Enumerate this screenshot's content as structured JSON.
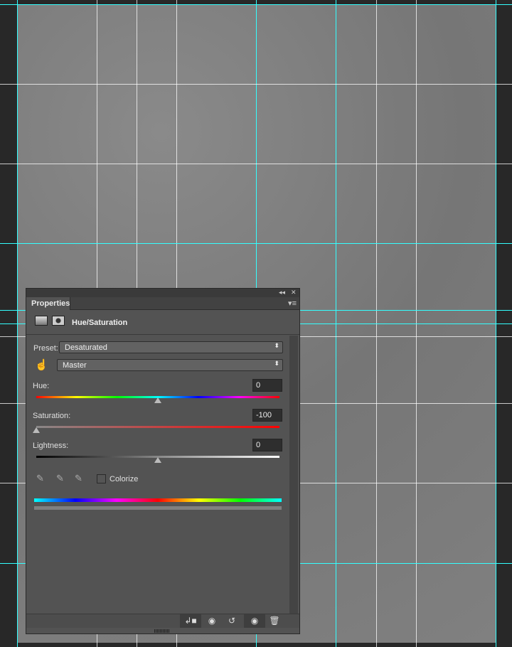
{
  "panel": {
    "tab": "Properties",
    "title": "Hue/Saturation",
    "preset_label": "Preset:",
    "preset_value": "Desaturated",
    "channel_value": "Master",
    "hue": {
      "label": "Hue:",
      "value": "0",
      "fraction": 0.5
    },
    "saturation": {
      "label": "Saturation:",
      "value": "-100",
      "fraction": 0.0
    },
    "lightness": {
      "label": "Lightness:",
      "value": "0",
      "fraction": 0.5
    },
    "colorize_label": "Colorize",
    "icons": {
      "collapse": "◂◂",
      "close": "✕",
      "menu": "▾≡",
      "arrows": "⬍"
    }
  }
}
